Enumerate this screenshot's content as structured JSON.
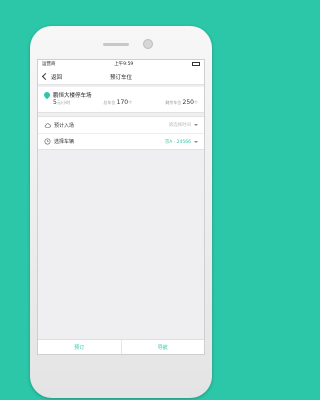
{
  "status_bar": {
    "carrier": "运营商",
    "time": "上午9:59"
  },
  "nav": {
    "back_label": "返回",
    "title": "预订车位"
  },
  "parking": {
    "name": "鹏恒大楼停车场",
    "price_value": "5",
    "price_unit": "元/小时",
    "total_label": "总车位",
    "total_value": "170",
    "total_unit": "个",
    "remaining_label": "剩余车位",
    "remaining_value": "250",
    "remaining_unit": "个"
  },
  "form": {
    "arrival_label": "预计入场",
    "arrival_placeholder": "请选择时间",
    "vehicle_label": "选择车辆",
    "vehicle_value": "京A · 24566"
  },
  "actions": {
    "reserve_label": "预订",
    "navigate_label": "导航"
  },
  "colors": {
    "brand": "#2cc6a9"
  }
}
